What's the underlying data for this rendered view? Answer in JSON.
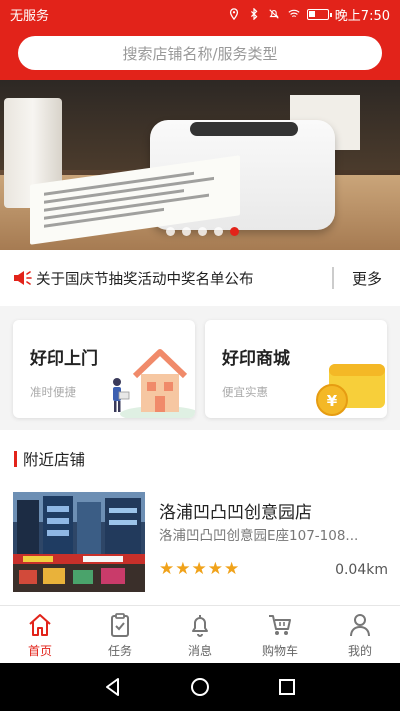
{
  "status_bar": {
    "carrier": "无服务",
    "time": "晚上7:50",
    "battery_level": 0.3
  },
  "search": {
    "placeholder": "搜索店铺名称/服务类型"
  },
  "banner": {
    "slide_count": 5,
    "active_index": 4
  },
  "notice": {
    "icon": "speaker-icon",
    "text": "关于国庆节抽奖活动中奖名单公布",
    "more_label": "更多"
  },
  "service_cards": [
    {
      "title": "好印上门",
      "subtitle": "准时便捷",
      "icon": "house-icon"
    },
    {
      "title": "好印商城",
      "subtitle": "便宜实惠",
      "icon": "wallet-coin-icon"
    }
  ],
  "nearby": {
    "heading": "附近店铺",
    "stores": [
      {
        "name": "洛浦凹凸凹创意园店",
        "address": "洛浦凹凸凹创意园E座107-108...",
        "rating": 5,
        "stars": "★★★★★",
        "distance": "0.04km"
      }
    ]
  },
  "tabbar": {
    "tabs": [
      {
        "label": "首页",
        "icon": "home-icon",
        "active": true
      },
      {
        "label": "任务",
        "icon": "clipboard-icon",
        "active": false
      },
      {
        "label": "消息",
        "icon": "bell-icon",
        "active": false
      },
      {
        "label": "购物车",
        "icon": "cart-icon",
        "active": false
      },
      {
        "label": "我的",
        "icon": "user-icon",
        "active": false
      }
    ]
  },
  "colors": {
    "accent": "#e2231a",
    "star": "#f0a21a"
  }
}
